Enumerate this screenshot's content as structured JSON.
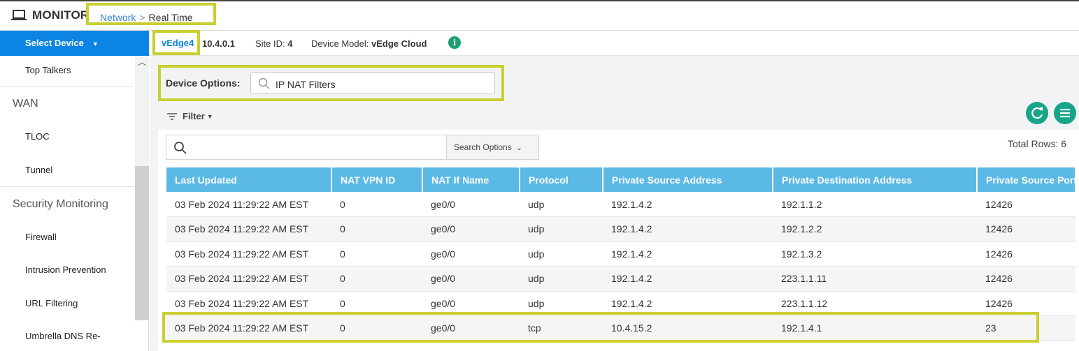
{
  "header": {
    "app_title": "MONITOR",
    "breadcrumb": {
      "link": "Network",
      "separator": ">",
      "current": "Real Time"
    }
  },
  "sidebar": {
    "select_device": "Select Device",
    "items": [
      {
        "type": "item",
        "label": "Top Talkers"
      },
      {
        "type": "heading",
        "label": "WAN"
      },
      {
        "type": "item",
        "label": "TLOC"
      },
      {
        "type": "item",
        "label": "Tunnel"
      },
      {
        "type": "heading",
        "label": "Security Monitoring"
      },
      {
        "type": "item",
        "label": "Firewall"
      },
      {
        "type": "item",
        "label": "Intrusion Prevention"
      },
      {
        "type": "item",
        "label": "URL Filtering"
      },
      {
        "type": "item",
        "label": "Umbrella DNS Re-"
      }
    ]
  },
  "device": {
    "hostname": "vEdge4",
    "ip": "10.4.0.1",
    "site_label": "Site ID:",
    "site_id": "4",
    "model_label": "Device Model:",
    "model": "vEdge Cloud",
    "info_icon": "i"
  },
  "device_options": {
    "label": "Device Options:",
    "value": "IP NAT Filters"
  },
  "filter": {
    "label": "Filter"
  },
  "search": {
    "placeholder": "",
    "options_label": "Search Options",
    "total_rows": "Total Rows: 6"
  },
  "table": {
    "columns": [
      "Last Updated",
      "NAT VPN ID",
      "NAT If Name",
      "Protocol",
      "Private Source Address",
      "Private Destination Address",
      "Private Source Port"
    ],
    "rows": [
      [
        "03 Feb 2024 11:29:22 AM EST",
        "0",
        "ge0/0",
        "udp",
        "192.1.4.2",
        "192.1.1.2",
        "12426"
      ],
      [
        "03 Feb 2024 11:29:22 AM EST",
        "0",
        "ge0/0",
        "udp",
        "192.1.4.2",
        "192.1.2.2",
        "12426"
      ],
      [
        "03 Feb 2024 11:29:22 AM EST",
        "0",
        "ge0/0",
        "udp",
        "192.1.4.2",
        "192.1.3.2",
        "12426"
      ],
      [
        "03 Feb 2024 11:29:22 AM EST",
        "0",
        "ge0/0",
        "udp",
        "192.1.4.2",
        "223.1.1.11",
        "12426"
      ],
      [
        "03 Feb 2024 11:29:22 AM EST",
        "0",
        "ge0/0",
        "udp",
        "192.1.4.2",
        "223.1.1.12",
        "12426"
      ],
      [
        "03 Feb 2024 11:29:22 AM EST",
        "0",
        "ge0/0",
        "tcp",
        "10.4.15.2",
        "192.1.4.1",
        "23"
      ]
    ]
  },
  "colors": {
    "accent_blue": "#0b84e3",
    "header_blue": "#5bb9e6",
    "teal": "#17a589",
    "highlight": "#c9cf30"
  }
}
